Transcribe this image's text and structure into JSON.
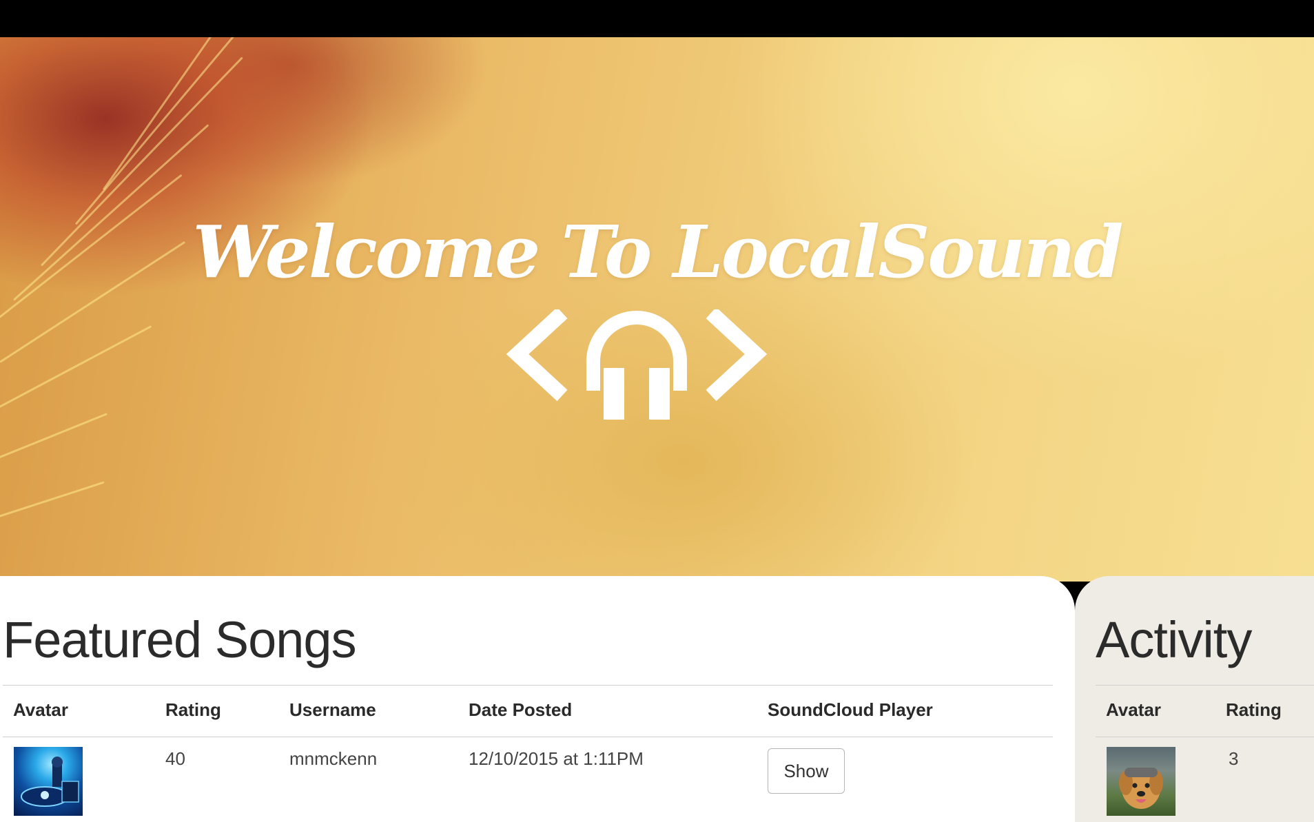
{
  "hero": {
    "title": "Welcome To LocalSound",
    "logo_icon": "headphones-code-icon"
  },
  "featured": {
    "title": "Featured Songs",
    "columns": [
      "Avatar",
      "Rating",
      "Username",
      "Date Posted",
      "SoundCloud Player"
    ],
    "rows": [
      {
        "avatar_icon": "dj-turntable-avatar",
        "rating": "40",
        "username": "mnmckenn",
        "date_posted": "12/10/2015 at 1:11PM",
        "player_button": "Show"
      }
    ]
  },
  "activity": {
    "title": "Activity",
    "columns": [
      "Avatar",
      "Rating"
    ],
    "rows": [
      {
        "avatar_icon": "dog-avatar",
        "rating": "3"
      }
    ]
  },
  "colors": {
    "hero_base": "#f1cf7d",
    "side_panel": "#efece5",
    "text_dark": "#2b2b2b"
  }
}
